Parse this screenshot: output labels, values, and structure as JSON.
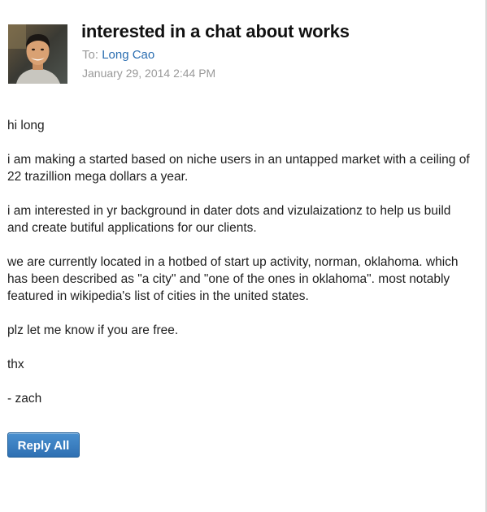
{
  "email": {
    "subject": "interested in a chat about works",
    "to_label": "To:",
    "to_name": "Long Cao",
    "date": "January 29, 2014 2:44 PM",
    "avatar_icon": "avatar-photo",
    "body": [
      "hi long",
      "i am making a started based on niche users in an untapped market with a ceiling of 22 trazillion mega dollars a year.",
      "i am interested in yr background in dater dots and vizulaizationz to help us build and create butiful applications for our clients.",
      "we are currently located in a hotbed of start up activity, norman, oklahoma. which has been described as \"a city\" and \"one of the ones in oklahoma\". most notably featured in wikipedia's list of cities in the united states.",
      "plz let me know if you are free.",
      "thx",
      "- zach"
    ]
  },
  "actions": {
    "reply_all_label": "Reply All"
  },
  "colors": {
    "link": "#2a6db0",
    "muted": "#999999",
    "button": "#3a7dc0"
  }
}
